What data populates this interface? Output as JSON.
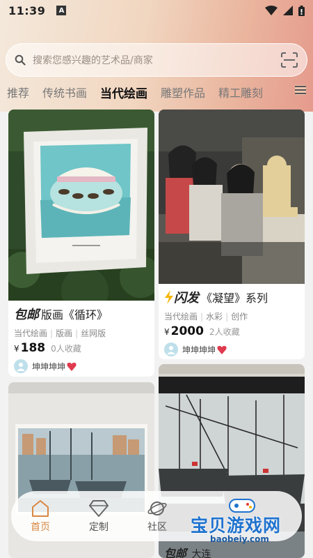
{
  "status": {
    "time": "11:39",
    "app_badge": "A"
  },
  "search": {
    "placeholder": "搜索您感兴趣的艺术品/商家"
  },
  "tabs": [
    {
      "label": "推荐",
      "active": false
    },
    {
      "label": "传统书画",
      "active": false
    },
    {
      "label": "当代绘画",
      "active": true
    },
    {
      "label": "雕塑作品",
      "active": false
    },
    {
      "label": "精工雕刻",
      "active": false
    }
  ],
  "cards": [
    {
      "badge": "包邮",
      "title": "版画《循环》",
      "tags": [
        "当代绘画",
        "版画",
        "丝网版"
      ],
      "currency": "¥",
      "price": "188",
      "favorites": "0人收藏",
      "seller": "坤坤坤坤"
    },
    {
      "badge": "闪发",
      "title": "《凝望》系列",
      "tags": [
        "当代绘画",
        "水彩",
        "创作"
      ],
      "currency": "¥",
      "price": "2000",
      "favorites": "2人收藏",
      "seller": "坤坤坤坤"
    }
  ],
  "peek": {
    "badge": "包邮",
    "title_fragment": "大连"
  },
  "bottom_nav": [
    {
      "label": "首页",
      "icon": "home-icon",
      "active": true
    },
    {
      "label": "定制",
      "icon": "diamond-icon",
      "active": false
    },
    {
      "label": "社区",
      "icon": "planet-icon",
      "active": false
    }
  ],
  "watermark": {
    "title": "宝贝游戏网",
    "url": "baobeiy.com"
  },
  "colors": {
    "accent": "#d98742",
    "badge_red": "#e03a2e"
  }
}
